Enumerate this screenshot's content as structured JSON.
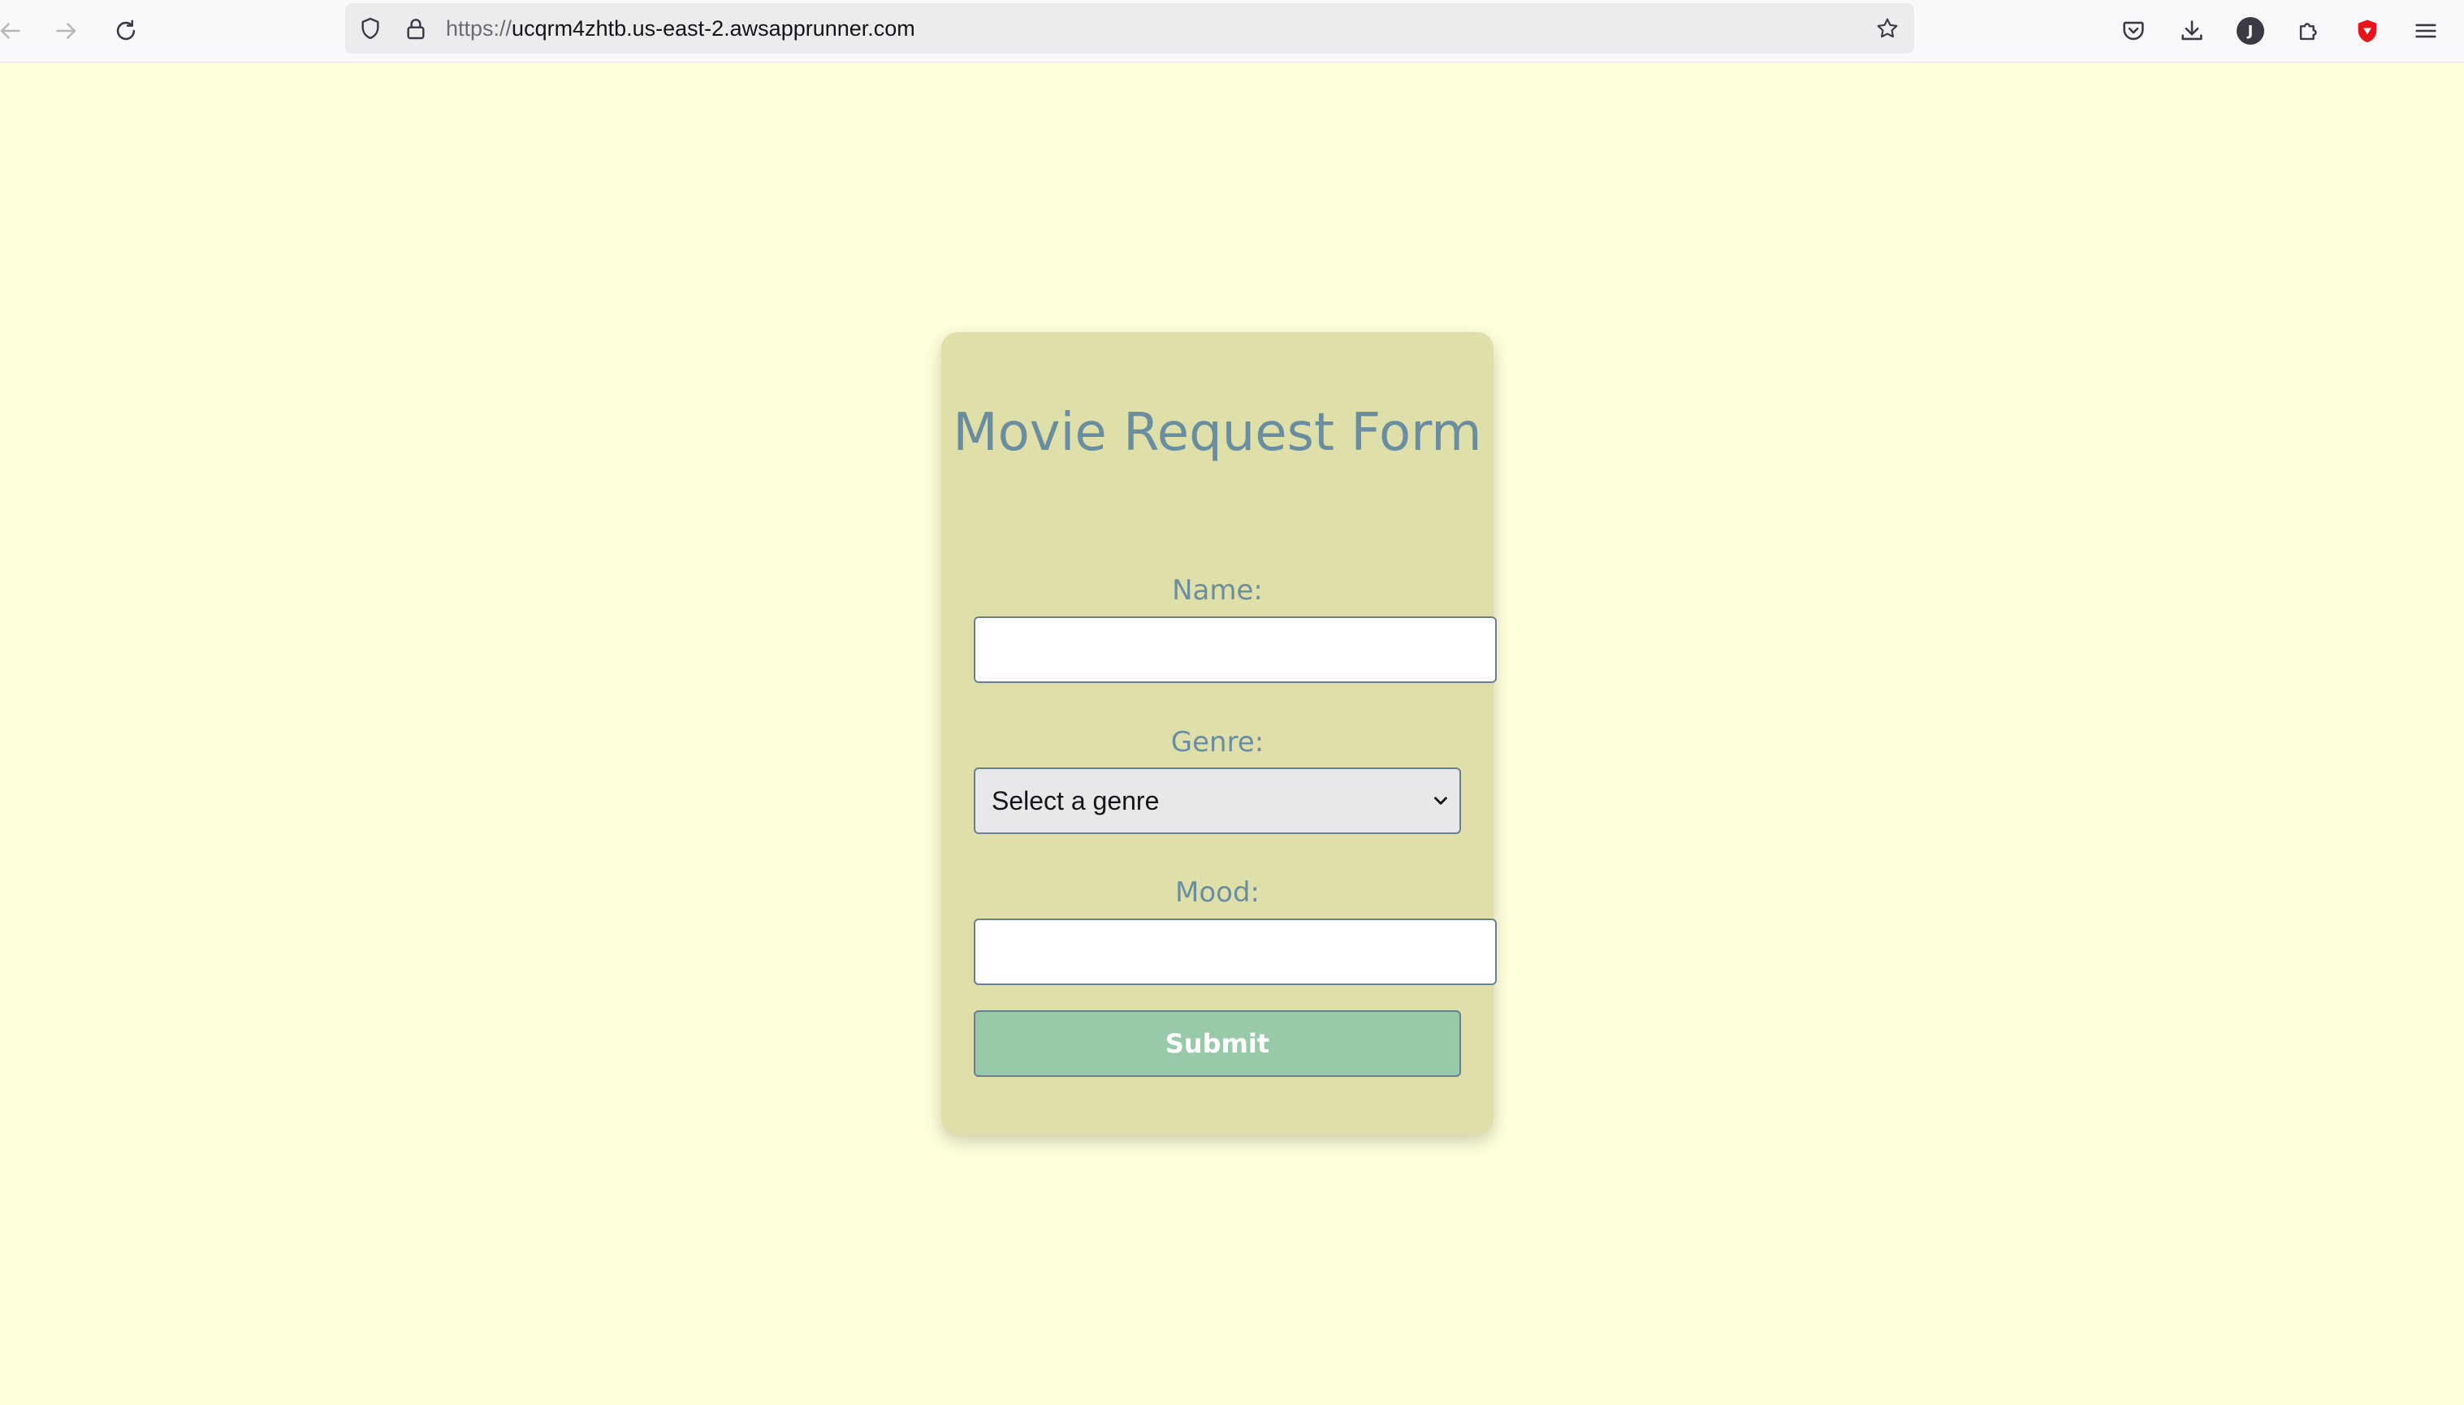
{
  "browser": {
    "url_scheme": "https://",
    "url_host": "ucqrm4zhtb.us-east-2.awsapprunner.com",
    "profile_initial": "J",
    "icons": {
      "back": "back-arrow-icon",
      "forward": "forward-arrow-icon",
      "reload": "reload-icon",
      "tracking_protection": "shield-icon",
      "site_security": "lock-icon",
      "bookmark": "star-icon",
      "pocket": "pocket-icon",
      "downloads": "download-icon",
      "extensions": "puzzle-icon",
      "ublock": "ublock-shield-icon",
      "menu": "hamburger-menu-icon"
    },
    "colors": {
      "toolbar_bg": "#f9f9fb",
      "urlbar_bg": "#ececef",
      "ublock_red": "#e8141b"
    }
  },
  "page": {
    "background": "#ffffdc",
    "form": {
      "title": "Movie Request Form",
      "name_label": "Name:",
      "name_value": "",
      "genre_label": "Genre:",
      "genre_selected": "Select a genre",
      "mood_label": "Mood:",
      "mood_value": "",
      "submit_label": "Submit"
    },
    "colors": {
      "card_bg": "#dedfa9",
      "heading_text": "#6a8da0",
      "submit_bg": "#98c9a8",
      "input_border": "#6b7f90"
    }
  }
}
